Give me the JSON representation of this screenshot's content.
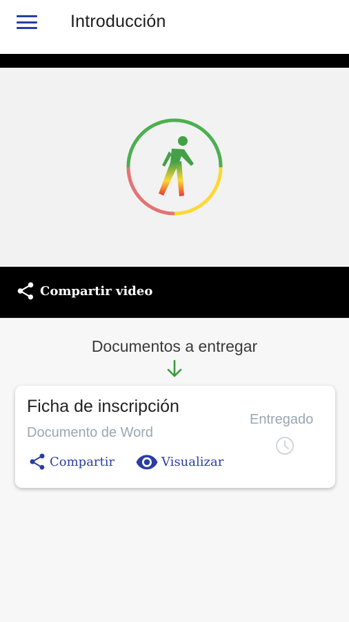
{
  "appbar": {
    "title": "Introducción",
    "menu_icon": "hamburger-menu-icon"
  },
  "video": {
    "logo_icon": "walking-person-logo",
    "share_label": "Compartir video",
    "share_icon": "share-icon"
  },
  "documents": {
    "heading": "Documentos a entregar",
    "arrow_icon": "arrow-down-icon",
    "items": [
      {
        "title": "Ficha de inscripción",
        "type": "Documento de Word",
        "status": "Entregado",
        "status_icon": "clock-icon",
        "share_label": "Compartir",
        "view_label": "Visualizar"
      }
    ]
  },
  "colors": {
    "accent": "#2a3da3",
    "green": "#4caf50",
    "yellow": "#fdd835",
    "red": "#e53935",
    "muted": "#9aa6b2"
  }
}
